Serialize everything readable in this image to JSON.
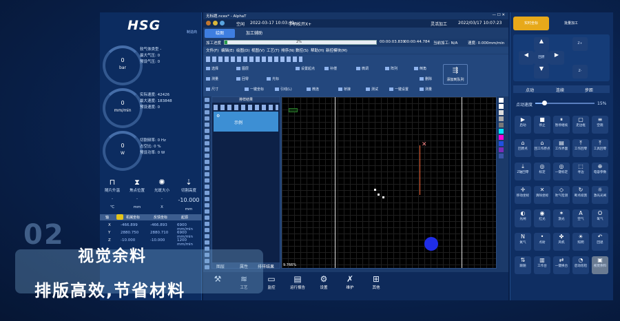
{
  "left_panel": {
    "logo": "HSG",
    "mfg": "制造商",
    "gauge1": {
      "value": "0",
      "unit": "bar",
      "lines": [
        "软气体类型 -",
        "最大气压: 0",
        "预设气压: 0"
      ]
    },
    "gauge2": {
      "value": "0",
      "unit": "mm/min",
      "lines": [
        "实际速度: 42426",
        "最大速度: 183848",
        "预设速度: 0"
      ]
    },
    "gauge3": {
      "value": "0",
      "unit": "W",
      "lines": [
        "切割频率: 0 Hz",
        "占空比: 0 %",
        "预设功率: 0 W"
      ]
    },
    "tools": [
      {
        "label": "随片升温",
        "value": "-",
        "unit": "℃"
      },
      {
        "label": "焦点位置",
        "value": "-",
        "unit": "mm"
      },
      {
        "label": "光斑大小",
        "value": "-",
        "unit": "X"
      },
      {
        "label": "切割高度",
        "value": "-10.000",
        "unit": "mm"
      }
    ],
    "axis_header": [
      "轴",
      "机械坐标",
      "反馈坐标",
      "起源"
    ],
    "axes": [
      {
        "name": "X",
        "a": "-466.899",
        "b": "-466.893",
        "c": "6900 mm/min"
      },
      {
        "name": "Y",
        "a": "2880.750",
        "b": "2880.710",
        "c": "6900 mm/min"
      },
      {
        "name": "Z",
        "a": "-10.000",
        "b": "-10.000",
        "c": "1200 mm/min"
      }
    ]
  },
  "main": {
    "title": "无标题.ncex* - AlphaT",
    "date_left": "2022-03-17 10:03:49",
    "status_text": "手柄松开X+",
    "app_right": "灵活加工",
    "date_right": "2022/03/17 10:07:23",
    "tabs": [
      "绘图",
      "加工辅助"
    ],
    "progress_label": "加工进度",
    "progress_percent": "2%",
    "progress_fraction": 0.02,
    "time_a": "00:00:03.839",
    "time_b": "00:00:44.784",
    "cur_label": "当前加工: N/A",
    "speed_label": "速度: 0.000mm/min",
    "menu": [
      "文件(F)",
      "编辑(E)",
      "绘图(D)",
      "视图(V)",
      "工艺(T)",
      "排序(N)",
      "数控(S)",
      "帮助(H)",
      "新控模块(M)"
    ],
    "toolbar_items": [
      "选择",
      "图层",
      "设置起点",
      "补偿",
      "微调",
      "阵列",
      "倒角",
      "测量",
      "回零",
      "光标",
      "尺寸",
      "一键坐标",
      "引线(L)",
      "微连",
      "桥接",
      "测试",
      "一键设置",
      "测量",
      "删除"
    ],
    "toolbar_big": "添加到队列",
    "layer_title": "排样结果",
    "layer_item": "示例",
    "layer_tabs": [
      "图层",
      "属性",
      "排样结果"
    ],
    "canvas_zoom": "9.766%"
  },
  "right_panel": {
    "top_buttons": [
      "实时坐标",
      "批量加工"
    ],
    "jog": {
      "up": "Y+",
      "down": "Y-",
      "left": "X-",
      "right": "X+",
      "center": "回原",
      "zup": "Z+",
      "zdown": "Z-"
    },
    "jog_tabs": [
      "点动",
      "连续",
      "步距"
    ],
    "speed_label": "点动速度",
    "speed_value": "15%",
    "grid1": [
      "启动",
      "停止",
      "暂停继续",
      "走边框",
      "空跑",
      "回原点",
      "回工作原点",
      "工作界面",
      "工作回零",
      "工具回零",
      "Z轴回零",
      "标定",
      "一键标定",
      "寻边",
      "电容参数",
      "移动坐标",
      "清除坐标",
      "吹气检测",
      "断点续割",
      "激光光闸",
      "光闸",
      "红光",
      "激光",
      "空气",
      "氧气",
      "氮气",
      "点射",
      "风机",
      "照明",
      "回退",
      "跟随",
      "工作台",
      "一键换台",
      "启动巡检",
      "视觉余料"
    ]
  },
  "bottom_nav": [
    "",
    "工艺",
    "监控",
    "运行报告",
    "设置",
    "维护",
    "其他"
  ],
  "overlay": {
    "number": "02",
    "line1": "视觉余料",
    "line2": "排版高效,节省材料"
  }
}
